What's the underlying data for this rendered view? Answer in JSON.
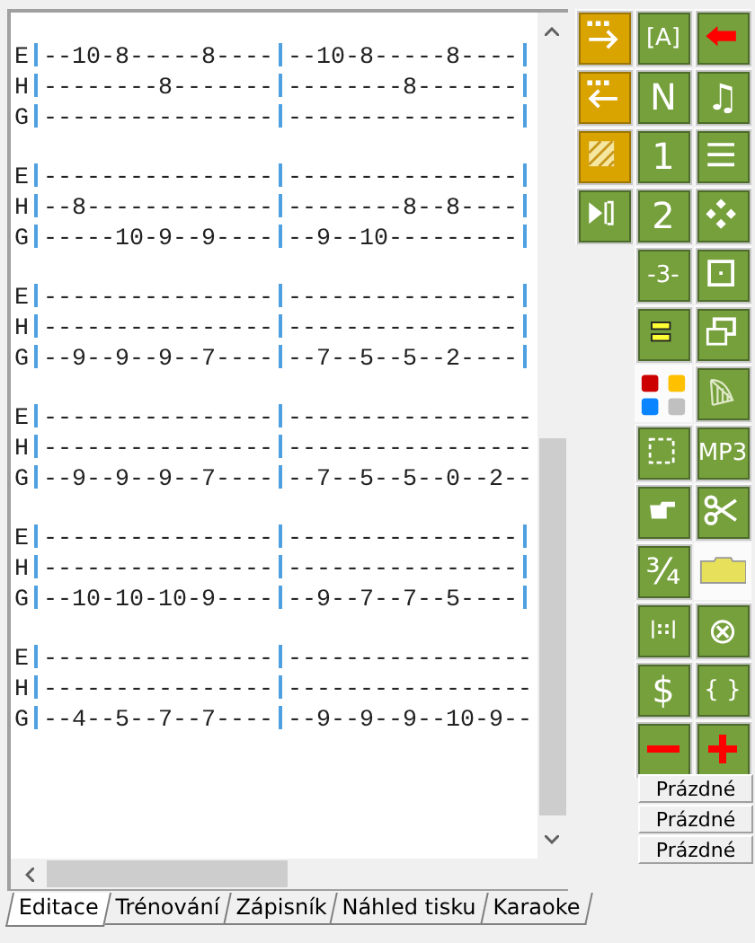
{
  "editor": {
    "blocks": [
      {
        "lines": [
          {
            "string": "E",
            "measures": [
              "--10-8-----8----",
              "--10-8-----8----"
            ],
            "end_bar": true
          },
          {
            "string": "H",
            "measures": [
              "--------8-------",
              "--------8-------"
            ],
            "end_bar": true
          },
          {
            "string": "G",
            "measures": [
              "----------------",
              "----------------"
            ],
            "end_bar": true
          }
        ]
      },
      {
        "lines": [
          {
            "string": "E",
            "measures": [
              "----------------",
              "----------------"
            ],
            "end_bar": true
          },
          {
            "string": "H",
            "measures": [
              "--8-------------",
              "--------8--8----"
            ],
            "end_bar": true
          },
          {
            "string": "G",
            "measures": [
              "-----10-9--9----",
              "--9--10---------"
            ],
            "end_bar": true
          }
        ]
      },
      {
        "lines": [
          {
            "string": "E",
            "measures": [
              "----------------",
              "----------------"
            ],
            "end_bar": true
          },
          {
            "string": "H",
            "measures": [
              "----------------",
              "----------------"
            ],
            "end_bar": true
          },
          {
            "string": "G",
            "measures": [
              "--9--9--9--7----",
              "--7--5--5--2----"
            ],
            "end_bar": true
          }
        ]
      },
      {
        "lines": [
          {
            "string": "E",
            "measures": [
              "----------------",
              "-----------------"
            ],
            "end_bar": false
          },
          {
            "string": "H",
            "measures": [
              "----------------",
              "-----------------"
            ],
            "end_bar": false
          },
          {
            "string": "G",
            "measures": [
              "--9--9--9--7----",
              "--7--5--5--0--2--"
            ],
            "end_bar": false
          }
        ]
      },
      {
        "lines": [
          {
            "string": "E",
            "measures": [
              "----------------",
              "----------------"
            ],
            "end_bar": true
          },
          {
            "string": "H",
            "measures": [
              "----------------",
              "----------------"
            ],
            "end_bar": true
          },
          {
            "string": "G",
            "measures": [
              "--10-10-10-9----",
              "--9--7--7--5----"
            ],
            "end_bar": true
          }
        ]
      },
      {
        "lines": [
          {
            "string": "E",
            "measures": [
              "----------------",
              "-----------------"
            ],
            "end_bar": false
          },
          {
            "string": "H",
            "measures": [
              "----------------",
              "-----------------"
            ],
            "end_bar": false
          },
          {
            "string": "G",
            "measures": [
              "--4--5--7--7----",
              "--9--9--9--10-9--"
            ],
            "end_bar": false
          }
        ]
      }
    ]
  },
  "tabs": [
    {
      "label": "Editace",
      "selected": true
    },
    {
      "label": "Trénování",
      "selected": false
    },
    {
      "label": "Zápisník",
      "selected": false
    },
    {
      "label": "Náhled tisku",
      "selected": false
    },
    {
      "label": "Karaoke",
      "selected": false
    }
  ],
  "tools": [
    [
      {
        "kind": "gold"
      },
      {
        "kind": "gold"
      },
      {
        "kind": "gold"
      },
      {
        "kind": "green"
      }
    ],
    [
      {
        "kind": "green",
        "label": "[A]"
      },
      {
        "kind": "green",
        "label": "N"
      },
      {
        "kind": "green",
        "label": "1"
      },
      {
        "kind": "green",
        "label": "2"
      },
      {
        "kind": "green",
        "label": "-3-"
      },
      {
        "kind": "green"
      },
      {
        "kind": "bare"
      },
      {
        "kind": "green"
      },
      {
        "kind": "green"
      },
      {
        "kind": "green",
        "label": "¾"
      },
      {
        "kind": "green",
        "label": "|::|"
      },
      {
        "kind": "green",
        "label": "$"
      },
      {
        "kind": "green"
      }
    ],
    [
      {
        "kind": "green"
      },
      {
        "kind": "green",
        "label": "♫"
      },
      {
        "kind": "green"
      },
      {
        "kind": "green"
      },
      {
        "kind": "green"
      },
      {
        "kind": "green"
      },
      {
        "kind": "green"
      },
      {
        "kind": "green",
        "label": "MP3"
      },
      {
        "kind": "green"
      },
      {
        "kind": "bare"
      },
      {
        "kind": "green",
        "label": "⊗"
      },
      {
        "kind": "green",
        "label": "{ }"
      },
      {
        "kind": "green"
      }
    ]
  ],
  "slots": [
    "Prázdné",
    "Prázdné",
    "Prázdné"
  ]
}
